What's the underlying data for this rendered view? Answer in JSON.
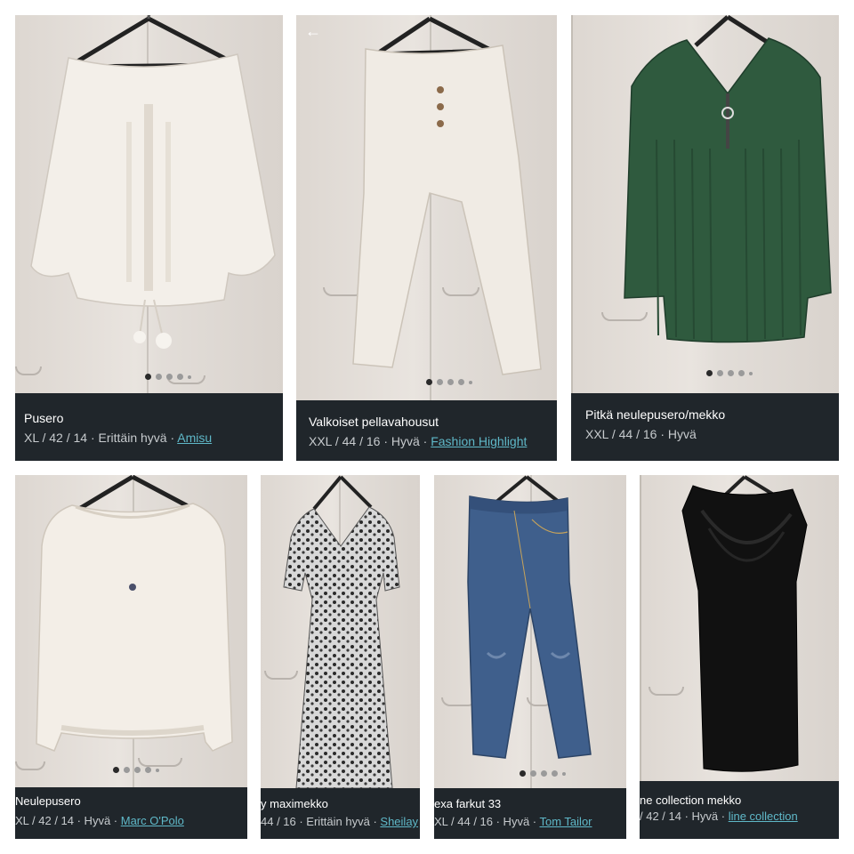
{
  "cards": [
    {
      "title": "Pusero",
      "meta": "XL / 42 / 14 · Erittäin hyvä · ",
      "brand": "Amisu"
    },
    {
      "title": "Valkoiset pellavahousut",
      "meta": "XXL / 44 / 16 · Hyvä · ",
      "brand": "Fashion Highlight"
    },
    {
      "title": "Pitkä neulepusero/mekko",
      "meta": "XXL / 44 / 16 · Hyvä",
      "brand": ""
    },
    {
      "title": "Neulepusero",
      "meta": "XL / 42 / 14 · Hyvä · ",
      "brand": "Marc O'Polo"
    },
    {
      "title": "y maximekko",
      "meta": "44 / 16 · Erittäin hyvä · ",
      "brand": "Sheilay"
    },
    {
      "title": "exa farkut 33",
      "meta": "XL / 44 / 16 · Hyvä · ",
      "brand": "Tom Tailor"
    },
    {
      "title": "ne collection mekko",
      "meta": "/ 42 / 14 · Hyvä · ",
      "brand": "line collection"
    }
  ],
  "icons": {
    "back": "back-arrow-icon"
  },
  "colors": {
    "info_bg": "#20262b",
    "brand_link": "#5fb8c8"
  }
}
